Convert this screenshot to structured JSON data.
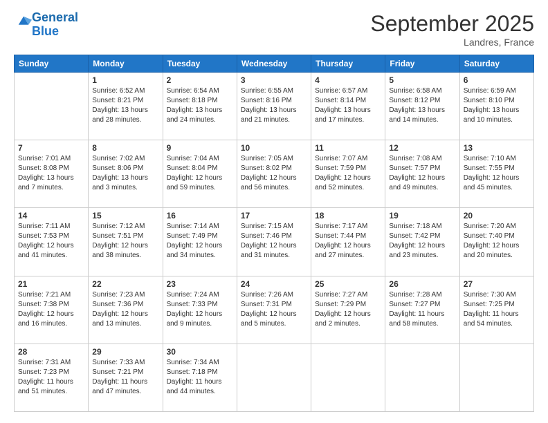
{
  "header": {
    "logo_line1": "General",
    "logo_line2": "Blue",
    "month_title": "September 2025",
    "location": "Landres, France"
  },
  "days_of_week": [
    "Sunday",
    "Monday",
    "Tuesday",
    "Wednesday",
    "Thursday",
    "Friday",
    "Saturday"
  ],
  "weeks": [
    [
      {
        "day": "",
        "info": ""
      },
      {
        "day": "1",
        "info": "Sunrise: 6:52 AM\nSunset: 8:21 PM\nDaylight: 13 hours and 28 minutes."
      },
      {
        "day": "2",
        "info": "Sunrise: 6:54 AM\nSunset: 8:18 PM\nDaylight: 13 hours and 24 minutes."
      },
      {
        "day": "3",
        "info": "Sunrise: 6:55 AM\nSunset: 8:16 PM\nDaylight: 13 hours and 21 minutes."
      },
      {
        "day": "4",
        "info": "Sunrise: 6:57 AM\nSunset: 8:14 PM\nDaylight: 13 hours and 17 minutes."
      },
      {
        "day": "5",
        "info": "Sunrise: 6:58 AM\nSunset: 8:12 PM\nDaylight: 13 hours and 14 minutes."
      },
      {
        "day": "6",
        "info": "Sunrise: 6:59 AM\nSunset: 8:10 PM\nDaylight: 13 hours and 10 minutes."
      }
    ],
    [
      {
        "day": "7",
        "info": "Sunrise: 7:01 AM\nSunset: 8:08 PM\nDaylight: 13 hours and 7 minutes."
      },
      {
        "day": "8",
        "info": "Sunrise: 7:02 AM\nSunset: 8:06 PM\nDaylight: 13 hours and 3 minutes."
      },
      {
        "day": "9",
        "info": "Sunrise: 7:04 AM\nSunset: 8:04 PM\nDaylight: 12 hours and 59 minutes."
      },
      {
        "day": "10",
        "info": "Sunrise: 7:05 AM\nSunset: 8:02 PM\nDaylight: 12 hours and 56 minutes."
      },
      {
        "day": "11",
        "info": "Sunrise: 7:07 AM\nSunset: 7:59 PM\nDaylight: 12 hours and 52 minutes."
      },
      {
        "day": "12",
        "info": "Sunrise: 7:08 AM\nSunset: 7:57 PM\nDaylight: 12 hours and 49 minutes."
      },
      {
        "day": "13",
        "info": "Sunrise: 7:10 AM\nSunset: 7:55 PM\nDaylight: 12 hours and 45 minutes."
      }
    ],
    [
      {
        "day": "14",
        "info": "Sunrise: 7:11 AM\nSunset: 7:53 PM\nDaylight: 12 hours and 41 minutes."
      },
      {
        "day": "15",
        "info": "Sunrise: 7:12 AM\nSunset: 7:51 PM\nDaylight: 12 hours and 38 minutes."
      },
      {
        "day": "16",
        "info": "Sunrise: 7:14 AM\nSunset: 7:49 PM\nDaylight: 12 hours and 34 minutes."
      },
      {
        "day": "17",
        "info": "Sunrise: 7:15 AM\nSunset: 7:46 PM\nDaylight: 12 hours and 31 minutes."
      },
      {
        "day": "18",
        "info": "Sunrise: 7:17 AM\nSunset: 7:44 PM\nDaylight: 12 hours and 27 minutes."
      },
      {
        "day": "19",
        "info": "Sunrise: 7:18 AM\nSunset: 7:42 PM\nDaylight: 12 hours and 23 minutes."
      },
      {
        "day": "20",
        "info": "Sunrise: 7:20 AM\nSunset: 7:40 PM\nDaylight: 12 hours and 20 minutes."
      }
    ],
    [
      {
        "day": "21",
        "info": "Sunrise: 7:21 AM\nSunset: 7:38 PM\nDaylight: 12 hours and 16 minutes."
      },
      {
        "day": "22",
        "info": "Sunrise: 7:23 AM\nSunset: 7:36 PM\nDaylight: 12 hours and 13 minutes."
      },
      {
        "day": "23",
        "info": "Sunrise: 7:24 AM\nSunset: 7:33 PM\nDaylight: 12 hours and 9 minutes."
      },
      {
        "day": "24",
        "info": "Sunrise: 7:26 AM\nSunset: 7:31 PM\nDaylight: 12 hours and 5 minutes."
      },
      {
        "day": "25",
        "info": "Sunrise: 7:27 AM\nSunset: 7:29 PM\nDaylight: 12 hours and 2 minutes."
      },
      {
        "day": "26",
        "info": "Sunrise: 7:28 AM\nSunset: 7:27 PM\nDaylight: 11 hours and 58 minutes."
      },
      {
        "day": "27",
        "info": "Sunrise: 7:30 AM\nSunset: 7:25 PM\nDaylight: 11 hours and 54 minutes."
      }
    ],
    [
      {
        "day": "28",
        "info": "Sunrise: 7:31 AM\nSunset: 7:23 PM\nDaylight: 11 hours and 51 minutes."
      },
      {
        "day": "29",
        "info": "Sunrise: 7:33 AM\nSunset: 7:21 PM\nDaylight: 11 hours and 47 minutes."
      },
      {
        "day": "30",
        "info": "Sunrise: 7:34 AM\nSunset: 7:18 PM\nDaylight: 11 hours and 44 minutes."
      },
      {
        "day": "",
        "info": ""
      },
      {
        "day": "",
        "info": ""
      },
      {
        "day": "",
        "info": ""
      },
      {
        "day": "",
        "info": ""
      }
    ]
  ]
}
